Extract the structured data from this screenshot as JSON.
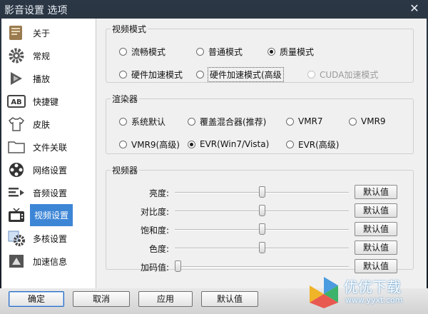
{
  "window": {
    "title": "影音设置 选项",
    "close_glyph": "✕"
  },
  "sidebar": {
    "items": [
      {
        "label": "关于",
        "icon": "scroll-icon"
      },
      {
        "label": "常规",
        "icon": "gear-icon"
      },
      {
        "label": "播放",
        "icon": "play-icon"
      },
      {
        "label": "快捷键",
        "icon": "keyboard-ab-icon"
      },
      {
        "label": "皮肤",
        "icon": "tshirt-icon"
      },
      {
        "label": "文件关联",
        "icon": "folder-icon"
      },
      {
        "label": "网络设置",
        "icon": "film-reel-icon"
      },
      {
        "label": "音频设置",
        "icon": "audio-lines-icon"
      },
      {
        "label": "视频设置",
        "icon": "tv-icon"
      },
      {
        "label": "多核设置",
        "icon": "multicore-gear-icon"
      },
      {
        "label": "加速信息",
        "icon": "accelerate-icon"
      }
    ],
    "selected": "视频设置"
  },
  "video_mode": {
    "legend": "视频模式",
    "options": [
      {
        "label": "流畅模式",
        "checked": false
      },
      {
        "label": "普通模式",
        "checked": false
      },
      {
        "label": "质量模式",
        "checked": true
      },
      {
        "label": "硬件加速模式",
        "checked": false
      },
      {
        "label": "硬件加速模式(高级",
        "checked": false
      },
      {
        "label": "CUDA加速模式",
        "checked": false,
        "disabled": true
      }
    ]
  },
  "renderer": {
    "legend": "渲染器",
    "options": [
      {
        "label": "系统默认",
        "checked": false
      },
      {
        "label": "覆盖混合器(推荐)",
        "checked": false
      },
      {
        "label": "VMR7",
        "checked": false
      },
      {
        "label": "VMR9",
        "checked": false
      },
      {
        "label": "VMR9(高级)",
        "checked": false
      },
      {
        "label": "EVR(Win7/Vista)",
        "checked": true
      },
      {
        "label": "EVR(高级)",
        "checked": false
      }
    ]
  },
  "video_adjust": {
    "legend": "视频器",
    "rows": [
      {
        "label": "亮度:",
        "value": 0.5,
        "button": "默认值"
      },
      {
        "label": "对比度:",
        "value": 0.5,
        "button": "默认值"
      },
      {
        "label": "饱和度:",
        "value": 0.5,
        "button": "默认值"
      },
      {
        "label": "色度:",
        "value": 0.5,
        "button": "默认值"
      },
      {
        "label": "加码值:",
        "value": 0.0,
        "button": "默认值"
      }
    ]
  },
  "footer": {
    "ok": "确定",
    "cancel": "取消",
    "apply": "应用",
    "default": "默认值"
  },
  "watermark": {
    "text": "优优下载",
    "url": "www.yyxt.com"
  },
  "colors": {
    "selection": "#3d86d6",
    "titlebar": "#1b2530"
  }
}
